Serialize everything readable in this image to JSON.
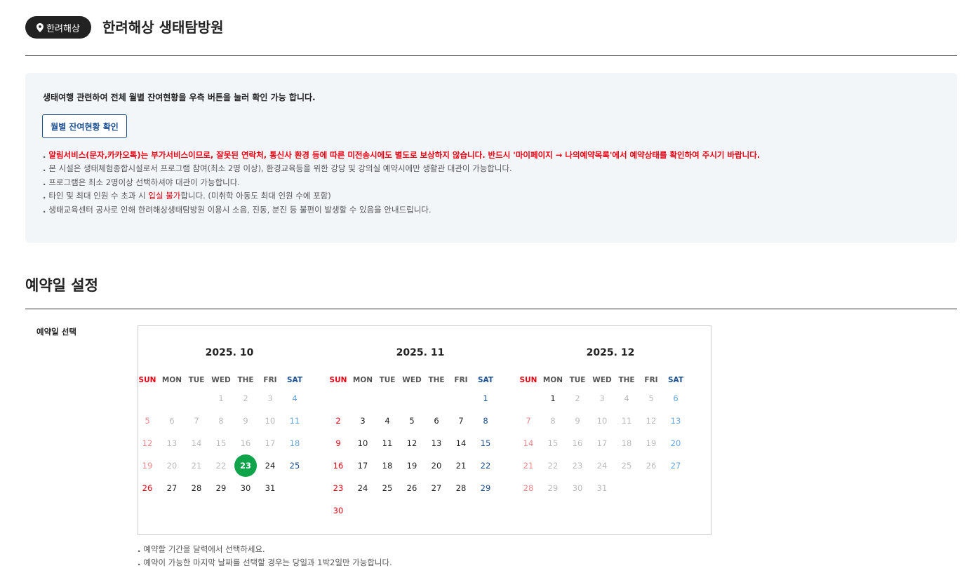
{
  "header": {
    "region_badge": "한려해상",
    "title": "한려해상 생태탐방원"
  },
  "notice": {
    "headline": "생태여행 관련하여 전체 월별 잔여현황을 우측 버튼을 눌러 확인 가능 합니다.",
    "monthly_button": "월별 잔여현황 확인",
    "items": {
      "alert": "알림서비스(문자,카카오톡)는 부가서비스이므로, 잘못된 연락처, 통신사 환경 등에 따른 미전송시에도 별도로 보상하지 않습니다. 반드시 '마이페이지 → 나의예약목록'에서 예약상태를 확인하여 주시기 바랍니다.",
      "facility": "본 시설은 생태체험종합시설로서 프로그램 참여(최소 2명 이상), 환경교육등을 위한 강당 및 강의실 예약시에만 생활관 대관이 가능합니다.",
      "minimum": "프로그램은 최소 2명이상 선택하셔야 대관이 가능합니다.",
      "capacity_pre": "타인 및 최대 인원 수 초과 시 ",
      "capacity_red": "입실 불가",
      "capacity_post": "합니다. (미취학 아동도 최대 인원 수에 포함)",
      "construction": "생태교육센터 공사로 인해 한려해상생태탐방원 이용시 소음, 진동, 분진 등 불편이 발생할 수 있음을 안내드립니다."
    }
  },
  "section": {
    "title": "예약일 설정",
    "field_label": "예약일 선택"
  },
  "calendar": {
    "weekdays": [
      "SUN",
      "MON",
      "TUE",
      "WED",
      "THE",
      "FRI",
      "SAT"
    ],
    "months": [
      {
        "title": "2025. 10",
        "first_weekday": 3,
        "days": 31,
        "available_from": 23,
        "available_to": 31,
        "selected": 23
      },
      {
        "title": "2025. 11",
        "first_weekday": 6,
        "days": 30,
        "available_from": 1,
        "available_to": 30,
        "selected": null
      },
      {
        "title": "2025. 12",
        "first_weekday": 1,
        "days": 31,
        "available_from": 1,
        "available_to": 1,
        "selected": null
      }
    ]
  },
  "help": {
    "line1": "예약할 기간을 달력에서 선택하세요.",
    "line2": "예약이 가능한 마지막 날짜를 선택할 경우는 당일과 1박2일만 가능합니다."
  },
  "colors": {
    "selected": "#0fa34a",
    "sunday": "#e60012",
    "saturday": "#1d4f8f",
    "alert": "#e60012",
    "notice_bg": "#f3f6f9"
  }
}
